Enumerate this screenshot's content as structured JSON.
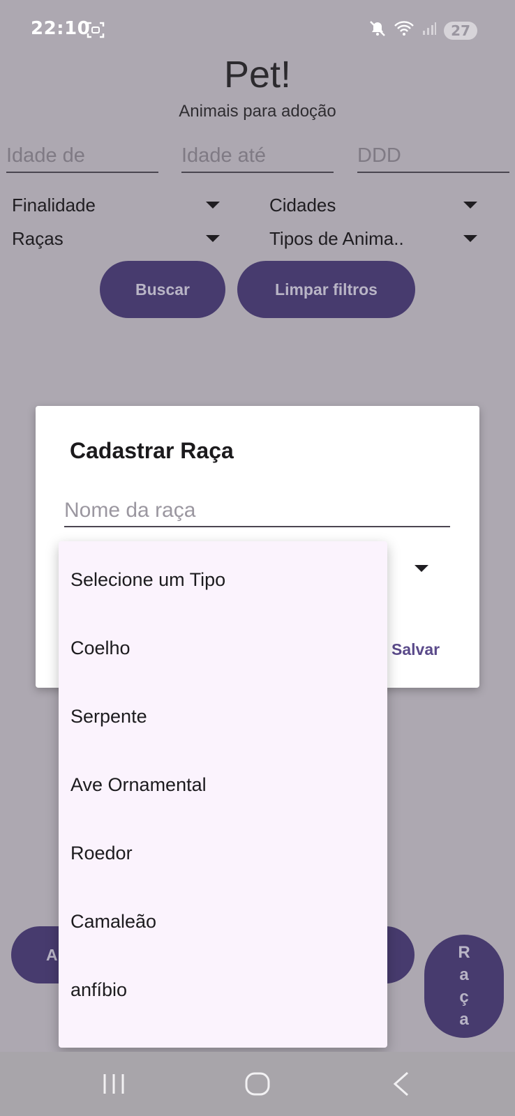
{
  "status_bar": {
    "time": "22:10",
    "battery": "27",
    "icons": [
      "screenshot-icon",
      "mute-icon",
      "wifi-icon",
      "signal-icon"
    ]
  },
  "header": {
    "title": "Pet!",
    "subtitle": "Animais para adoção"
  },
  "filters": {
    "idade_de_placeholder": "Idade de",
    "idade_ate_placeholder": "Idade até",
    "ddd_placeholder": "DDD",
    "finalidade_label": "Finalidade",
    "cidades_label": "Cidades",
    "racas_label": "Raças",
    "tipos_label": "Tipos de Anima.."
  },
  "actions": {
    "buscar_label": "Buscar",
    "limpar_label": "Limpar filtros"
  },
  "dialog": {
    "title": "Cadastrar Raça",
    "name_placeholder": "Nome da raça",
    "save_label": "Salvar"
  },
  "type_menu": {
    "options": [
      "Selecione um Tipo",
      "Coelho",
      "Serpente",
      "Ave Ornamental",
      "Roedor",
      "Camaleão",
      "anfíbio"
    ]
  },
  "bottom": {
    "left_button_partial": "A",
    "raca_button_letters": [
      "R",
      "a",
      "ç",
      "a"
    ]
  },
  "colors": {
    "overlay_background": "#ada8b1",
    "primary_button": "#473b6e",
    "menu_background": "#fbf3fd",
    "accent_text": "#5a4a8a"
  }
}
